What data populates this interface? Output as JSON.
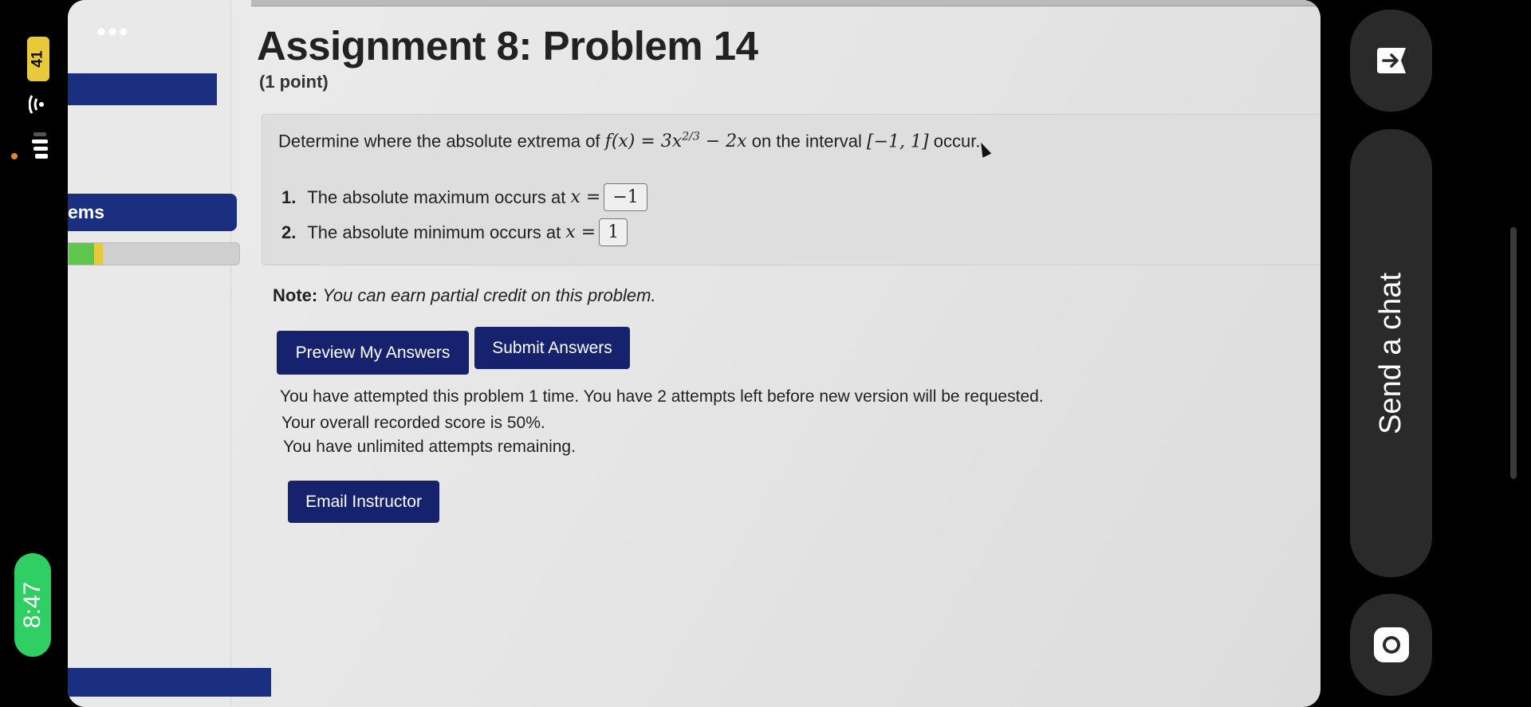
{
  "status": {
    "battery": "41",
    "clock": "8:47"
  },
  "sidebar": {
    "item_label": "ems",
    "progress_green": 0.15,
    "progress_yellow": 0.05
  },
  "header": {
    "title": "Assignment 8: Problem 14",
    "points": "(1 point)"
  },
  "problem": {
    "intro": "Determine where the absolute extrema of",
    "function": "f(x) = 3x",
    "exponent": "2/3",
    "function_tail": " − 2x",
    "interval_text": "on the interval",
    "interval": "[−1, 1]",
    "tail": "occur.",
    "answers": [
      {
        "num": "1.",
        "label": "The absolute maximum occurs at",
        "var": "x =",
        "value": "−1"
      },
      {
        "num": "2.",
        "label": "The absolute minimum occurs at",
        "var": "x =",
        "value": "1"
      }
    ]
  },
  "note": {
    "label": "Note:",
    "text": "You can earn partial credit on this problem."
  },
  "buttons": {
    "preview": "Preview My Answers",
    "submit": "Submit Answers",
    "email": "Email Instructor"
  },
  "messages": [
    "You have attempted this problem 1 time. You have 2 attempts left before new version will be requested.",
    "Your overall recorded score is 50%.",
    "You have unlimited attempts remaining."
  ],
  "right_panel": {
    "chat_label": "Send a chat"
  },
  "colors": {
    "nav_blue": "#1b2f80",
    "button_blue": "#16226e",
    "clock_green": "#2fcf63",
    "battery_yellow": "#e8c93a"
  }
}
